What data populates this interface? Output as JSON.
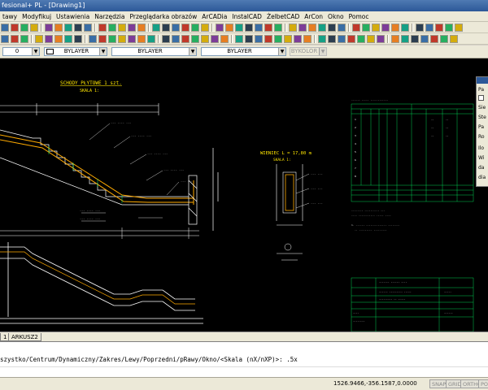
{
  "window": {
    "title": "fesional+ PL - [Drawing1]"
  },
  "menu": [
    "tawy",
    "Modyfikuj",
    "Ustawienia",
    "Narzędzia",
    "Przeglądarka obrazów",
    "ArCADia",
    "InstalCAD",
    "ŻelbetCAD",
    "ArCon",
    "Okno",
    "Pomoc"
  ],
  "properties_bar": {
    "layer": "0",
    "color": "BYLAYER",
    "linetype": "BYLAYER",
    "lineweight": "BYLAYER",
    "plotstyle": "BYKOLOR"
  },
  "drawing": {
    "stair_title": "SCHODY PŁYTOWE 1 szt.",
    "stair_scale": "SKALA 1:",
    "beam_title": "WIENIEC  L = 17,80 m",
    "beam_scale": "SKALA 1:"
  },
  "tabs": [
    "1",
    "ARKUSZ2"
  ],
  "command": {
    "prompt": "szystko/Centrum/Dynamiczny/Zakres/Lewy/Poprzedni/pRawy/Okno/<Skala (nX/nXP)>: .5x"
  },
  "status": {
    "coords": "1526.9466,-356.1587,0.0000",
    "buttons": [
      "SNAP",
      "GRID",
      "ORTHO",
      "POL"
    ]
  },
  "palette": {
    "items": [
      "Pa",
      "Sie",
      "Ste",
      "Pa",
      "Ro",
      "Ilo",
      "Wi",
      "da",
      "dia"
    ]
  }
}
